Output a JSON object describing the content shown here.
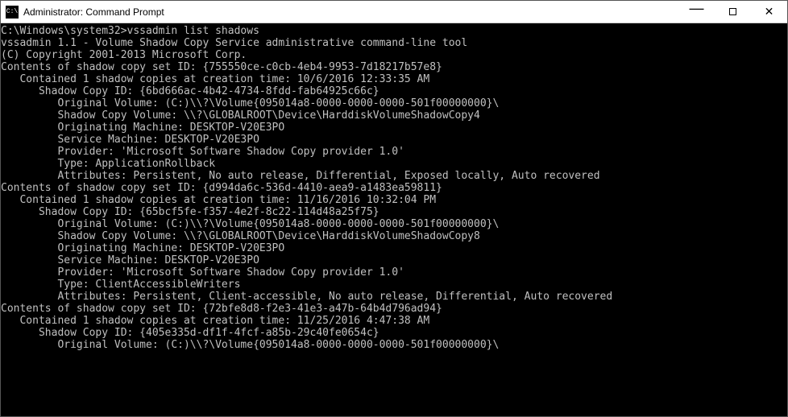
{
  "window": {
    "title": "Administrator: Command Prompt"
  },
  "terminal": {
    "lines": [
      "C:\\Windows\\system32>vssadmin list shadows",
      "vssadmin 1.1 - Volume Shadow Copy Service administrative command-line tool",
      "(C) Copyright 2001-2013 Microsoft Corp.",
      "",
      "Contents of shadow copy set ID: {755550ce-c0cb-4eb4-9953-7d18217b57e8}",
      "   Contained 1 shadow copies at creation time: 10/6/2016 12:33:35 AM",
      "      Shadow Copy ID: {6bd666ac-4b42-4734-8fdd-fab64925c66c}",
      "         Original Volume: (C:)\\\\?\\Volume{095014a8-0000-0000-0000-501f00000000}\\",
      "         Shadow Copy Volume: \\\\?\\GLOBALROOT\\Device\\HarddiskVolumeShadowCopy4",
      "         Originating Machine: DESKTOP-V20E3PO",
      "         Service Machine: DESKTOP-V20E3PO",
      "         Provider: 'Microsoft Software Shadow Copy provider 1.0'",
      "         Type: ApplicationRollback",
      "         Attributes: Persistent, No auto release, Differential, Exposed locally, Auto recovered",
      "",
      "Contents of shadow copy set ID: {d994da6c-536d-4410-aea9-a1483ea59811}",
      "   Contained 1 shadow copies at creation time: 11/16/2016 10:32:04 PM",
      "      Shadow Copy ID: {65bcf5fe-f357-4e2f-8c22-114d48a25f75}",
      "         Original Volume: (C:)\\\\?\\Volume{095014a8-0000-0000-0000-501f00000000}\\",
      "         Shadow Copy Volume: \\\\?\\GLOBALROOT\\Device\\HarddiskVolumeShadowCopy8",
      "         Originating Machine: DESKTOP-V20E3PO",
      "         Service Machine: DESKTOP-V20E3PO",
      "         Provider: 'Microsoft Software Shadow Copy provider 1.0'",
      "         Type: ClientAccessibleWriters",
      "         Attributes: Persistent, Client-accessible, No auto release, Differential, Auto recovered",
      "",
      "Contents of shadow copy set ID: {72bfe8d8-f2e3-41e3-a47b-64b4d796ad94}",
      "   Contained 1 shadow copies at creation time: 11/25/2016 4:47:38 AM",
      "      Shadow Copy ID: {405e335d-df1f-4fcf-a85b-29c40fe0654c}",
      "         Original Volume: (C:)\\\\?\\Volume{095014a8-0000-0000-0000-501f00000000}\\"
    ]
  }
}
